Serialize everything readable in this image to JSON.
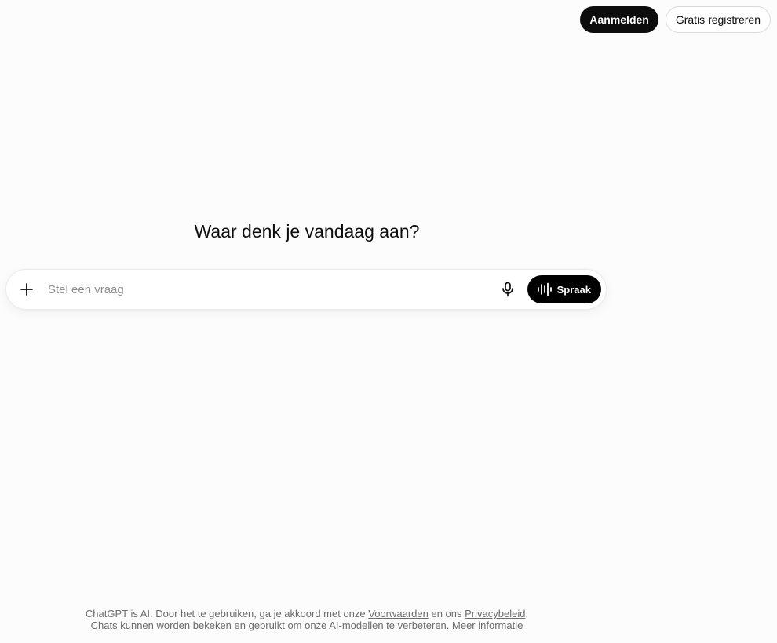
{
  "header": {
    "login_label": "Aanmelden",
    "register_label": "Gratis registreren"
  },
  "main": {
    "heading": "Waar denk je vandaag aan?"
  },
  "composer": {
    "placeholder": "Stel een vraag",
    "value": "",
    "voice_label": "Spraak",
    "icons": {
      "attach": "plus-icon",
      "dictate": "microphone-icon",
      "voice": "waveform-icon"
    }
  },
  "footer": {
    "line1_prefix": "ChatGPT is AI. Door het te gebruiken, ga je akkoord met onze ",
    "terms_link": "Voorwaarden",
    "line1_middle": " en ons ",
    "privacy_link": "Privacybeleid",
    "line1_suffix": ".",
    "line2_prefix": "Chats kunnen worden bekeken en gebruikt om onze AI-modellen te verbeteren. ",
    "more_info_link": "Meer informatie"
  },
  "colors": {
    "background": "#fcfcfc",
    "primary_button": "#0d0d0d",
    "text": "#0d0d0d",
    "muted_text": "#6b6b6b"
  }
}
